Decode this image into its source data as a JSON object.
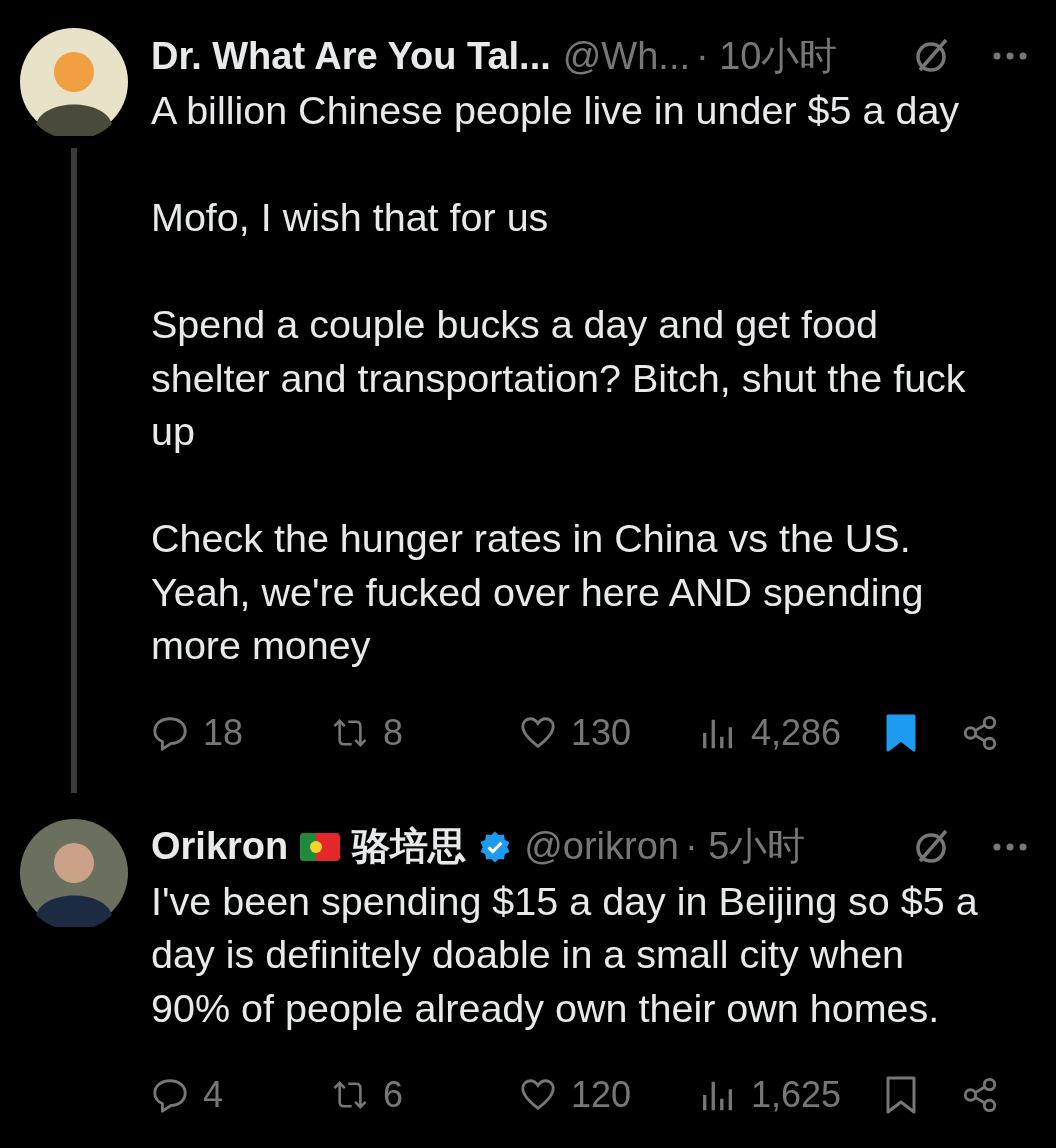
{
  "tweets": [
    {
      "name": "Dr. What Are You Tal...",
      "flag": false,
      "verified": false,
      "handle": "@Wh...",
      "time": "· 10小时",
      "thread_line": true,
      "paragraphs": [
        "A billion Chinese people live in under $5 a day",
        "Mofo, I wish that for us",
        "Spend a couple bucks a day and get food shelter and transportation? Bitch, shut the fuck up",
        "Check the hunger rates in China vs the US. Yeah, we're fucked over here AND spending more money"
      ],
      "replies": "18",
      "reposts": "8",
      "likes": "130",
      "views": "4,286",
      "bookmarked": true
    },
    {
      "name": "Orikron",
      "flag": true,
      "alt_name": "骆培思",
      "verified": true,
      "handle": "@orikron",
      "time": "· 5小时",
      "thread_line": false,
      "paragraphs": [
        "I've been spending $15 a day in Beijing so $5 a day is definitely doable in a small city when 90% of people already own their own homes."
      ],
      "replies": "4",
      "reposts": "6",
      "likes": "120",
      "views": "1,625",
      "bookmarked": false
    }
  ]
}
